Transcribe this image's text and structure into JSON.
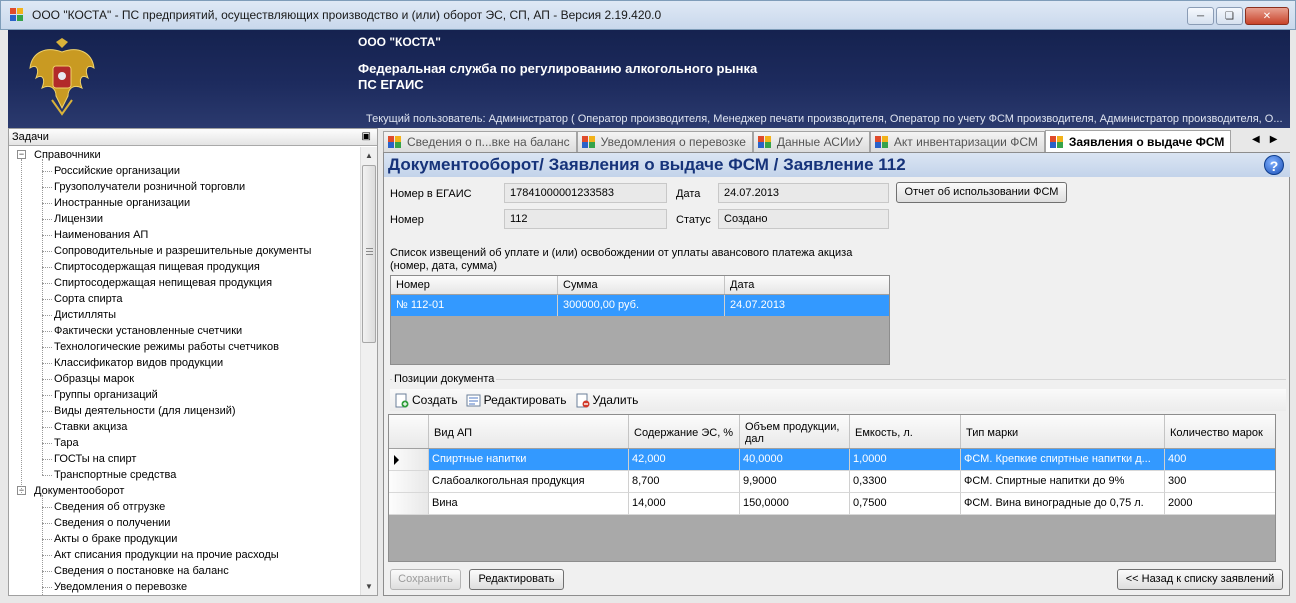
{
  "window": {
    "title": "ООО \"КОСТА\" - ПС предприятий, осуществляющих производство и (или) оборот ЭС, СП, АП - Версия 2.19.420.0"
  },
  "banner": {
    "org": "ООО \"КОСТА\"",
    "agency": "Федеральная служба по регулированию алкогольного рынка",
    "system": "ПС ЕГАИС",
    "user": "Текущий пользователь: Администратор ( Оператор производителя, Менеджер печати производителя, Оператор по учету ФСМ производителя, Администратор производителя, О..."
  },
  "tasks": {
    "header": "Задачи",
    "pin": "ф",
    "groups": [
      {
        "label": "Справочники",
        "items": [
          "Российские организации",
          "Грузополучатели розничной торговли",
          "Иностранные организации",
          "Лицензии",
          "Наименования АП",
          "Сопроводительные и разрешительные документы",
          "Спиртосодержащая пищевая продукция",
          "Спиртосодержащая непищевая продукция",
          "Сорта спирта",
          "Дистилляты",
          "Фактически установленные счетчики",
          "Технологические режимы работы счетчиков",
          "Классификатор видов продукции",
          "Образцы марок",
          "Группы организаций",
          "Виды деятельности (для лицензий)",
          "Ставки акциза",
          "Тара",
          "ГОСТы на спирт",
          "Транспортные средства"
        ]
      },
      {
        "label": "Документооборот",
        "items": [
          "Сведения об отгрузке",
          "Сведения о получении",
          "Акты о браке продукции",
          "Акт списания продукции на прочие расходы",
          "Сведения о постановке на баланс",
          "Уведомления о перевозке"
        ]
      }
    ]
  },
  "tabs": [
    {
      "label": "Сведения о п...вке на баланс",
      "active": false
    },
    {
      "label": "Уведомления о перевозке",
      "active": false
    },
    {
      "label": "Данные АСИиУ",
      "active": false
    },
    {
      "label": "Акт инвентаризации ФСМ",
      "active": false
    },
    {
      "label": "Заявления о выдаче ФСМ",
      "active": true
    }
  ],
  "doc": {
    "title": "Документооборот/ Заявления о выдаче ФСМ / Заявление 112",
    "egais_label": "Номер в ЕГАИС",
    "egais_value": "17841000001233583",
    "date_label": "Дата",
    "date_value": "24.07.2013",
    "report_button": "Отчет об использовании ФСМ",
    "number_label": "Номер",
    "number_value": "112",
    "status_label": "Статус",
    "status_value": "Создано",
    "notices_caption": "Список извещений об уплате и (или) освобождении от уплаты авансового платежа акциза (номер, дата, сумма)"
  },
  "notices": {
    "columns": [
      "Номер",
      "Сумма",
      "Дата"
    ],
    "rows": [
      {
        "num": "№ 112-01",
        "sum": "300000,00 руб.",
        "date": "24.07.2013"
      }
    ]
  },
  "positions": {
    "caption": "Позиции документа",
    "toolbar": {
      "create": "Создать",
      "edit": "Редактировать",
      "delete": "Удалить"
    },
    "columns": {
      "type": "Вид АП",
      "es": "Содержание ЭС, %",
      "volume": "Объем продукции, дал",
      "capacity": "Емкость, л.",
      "mark": "Тип марки",
      "count": "Количество марок"
    },
    "rows": [
      {
        "type": "Спиртные напитки",
        "es": "42,000",
        "volume": "40,0000",
        "capacity": "1,0000",
        "mark": "ФСМ. Крепкие спиртные напитки д...",
        "count": "400"
      },
      {
        "type": "Слабоалкогольная продукция",
        "es": "8,700",
        "volume": "9,9000",
        "capacity": "0,3300",
        "mark": "ФСМ. Спиртные напитки до 9%",
        "count": "300"
      },
      {
        "type": "Вина",
        "es": "14,000",
        "volume": "150,0000",
        "capacity": "0,7500",
        "mark": "ФСМ. Вина виноградные до 0,75 л.",
        "count": "2000"
      }
    ]
  },
  "footer": {
    "save": "Сохранить",
    "edit": "Редактировать",
    "back": "<< Назад к списку заявлений"
  },
  "colors": {
    "banner": "#1d2b5e",
    "selection": "#3399ff",
    "title_text": "#16337a"
  }
}
